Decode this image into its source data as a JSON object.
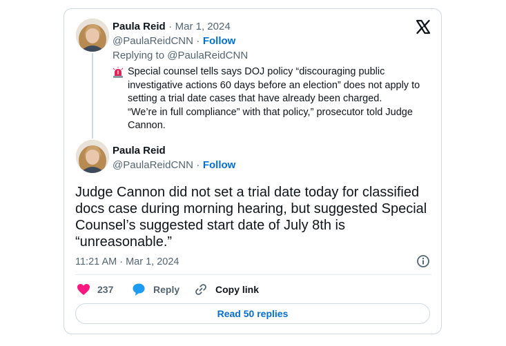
{
  "quoted": {
    "author_name": "Paula Reid",
    "separator": "·",
    "date": "Mar 1, 2024",
    "handle": "@PaulaReidCNN",
    "follow_label": "Follow",
    "replying_to": "Replying to @PaulaReidCNN",
    "text": "Special counsel tells says DOJ policy “discouraging public\ninvestigative actions 60 days before an election” does not apply to\nsetting a trial date cases that have already been charged.\n“We’re in full compliance” with that policy,” prosecutor told Judge\nCannon."
  },
  "tweet": {
    "author_name": "Paula Reid",
    "handle": "@PaulaReidCNN",
    "separator": "·",
    "follow_label": "Follow",
    "text": "Judge Cannon did not set a trial date today for classified\ndocs case during morning hearing, but suggested Special\nCounsel’s  suggested start date of July 8th is\n“unreasonable.”",
    "timestamp": "11:21 AM · Mar 1, 2024"
  },
  "actions": {
    "like_count": "237",
    "reply_label": "Reply",
    "copy_link_label": "Copy link"
  },
  "read_replies_label": "Read 50 replies",
  "icons": {
    "logo": "x-logo-icon",
    "siren": "rotating-light-icon",
    "info": "info-icon",
    "like": "heart-icon",
    "reply": "speech-bubble-icon",
    "copy": "link-icon"
  },
  "colors": {
    "like": "#f91880",
    "reply": "#1d9bf0",
    "follow": "#006fd6",
    "muted": "#536471"
  }
}
